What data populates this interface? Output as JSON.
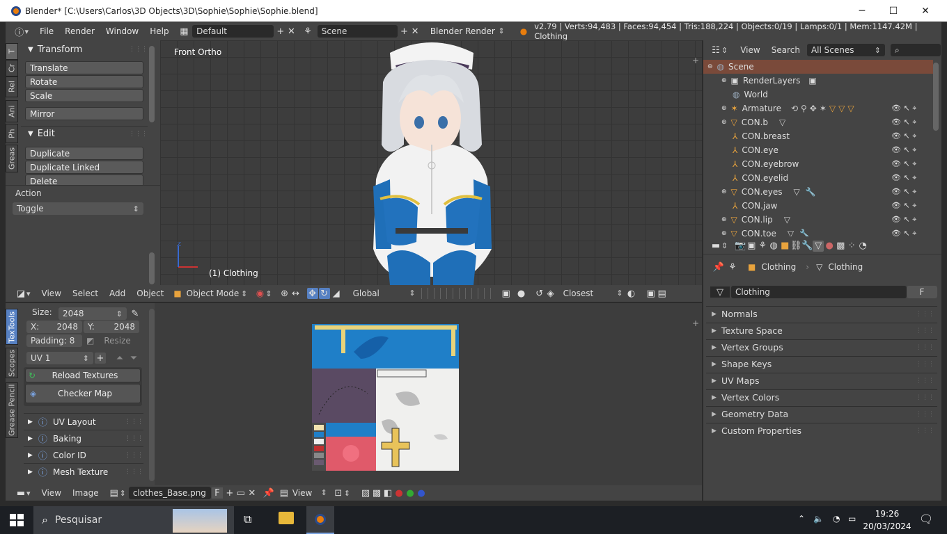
{
  "window": {
    "title": "Blender* [C:\\Users\\Carlos\\3D Objects\\3D\\Sophie\\Sophie\\Sophie.blend]",
    "minimize": "─",
    "maximize": "☐",
    "close": "✕"
  },
  "info_header": {
    "menus": [
      "File",
      "Render",
      "Window",
      "Help"
    ],
    "screen_layout": "Default",
    "scene": "Scene",
    "engine": "Blender Render",
    "stats": "v2.79 | Verts:94,483 | Faces:94,454 | Tris:188,224 | Objects:0/19 | Lamps:0/1 | Mem:1147.42M | Clothing"
  },
  "tool_shelf": {
    "tabs": [
      "T",
      "Cr",
      "Rel",
      "Ani",
      "Ph",
      "Greas"
    ],
    "transform_title": "Transform",
    "transform_buttons": [
      "Translate",
      "Rotate",
      "Scale"
    ],
    "mirror": "Mirror",
    "edit_title": "Edit",
    "edit_buttons": [
      "Duplicate",
      "Duplicate Linked",
      "Delete"
    ],
    "action_label": "Action",
    "action_value": "Toggle"
  },
  "viewport": {
    "label": "Front Ortho",
    "object_label": "(1) Clothing"
  },
  "view3d_header": {
    "menus": [
      "View",
      "Select",
      "Add",
      "Object"
    ],
    "mode": "Object Mode",
    "orientation": "Global",
    "snap": "Closest"
  },
  "image_tools": {
    "tabs": [
      "TexTools",
      "Scopes",
      "Grease Pencil"
    ],
    "size_label": "Size:",
    "size_value": "2048",
    "x_label": "X:",
    "x_value": "2048",
    "y_label": "Y:",
    "y_value": "2048",
    "padding": "Padding: 8",
    "resize": "Resize",
    "uv_map": "UV 1",
    "reload": "Reload Textures",
    "checker": "Checker Map",
    "panels": [
      "UV Layout",
      "Baking",
      "Color ID",
      "Mesh Texture"
    ]
  },
  "image_header": {
    "menus": [
      "View",
      "Image"
    ],
    "image_name": "clothes_Base.png",
    "f": "F",
    "view": "View"
  },
  "outliner": {
    "menus": [
      "View",
      "Search"
    ],
    "filter": "All Scenes",
    "rows": [
      {
        "name": "Scene",
        "indent": 0
      },
      {
        "name": "RenderLayers",
        "indent": 1
      },
      {
        "name": "World",
        "indent": 1
      },
      {
        "name": "Armature",
        "indent": 1
      },
      {
        "name": "CON.b",
        "indent": 1
      },
      {
        "name": "CON.breast",
        "indent": 1
      },
      {
        "name": "CON.eye",
        "indent": 1
      },
      {
        "name": "CON.eyebrow",
        "indent": 1
      },
      {
        "name": "CON.eyelid",
        "indent": 1
      },
      {
        "name": "CON.eyes",
        "indent": 1
      },
      {
        "name": "CON.jaw",
        "indent": 1
      },
      {
        "name": "CON.lip",
        "indent": 1
      },
      {
        "name": "CON.toe",
        "indent": 1
      }
    ]
  },
  "properties": {
    "breadcrumb_object": "Clothing",
    "breadcrumb_data": "Clothing",
    "datablock": "Clothing",
    "f": "F",
    "panels": [
      "Normals",
      "Texture Space",
      "Vertex Groups",
      "Shape Keys",
      "UV Maps",
      "Vertex Colors",
      "Geometry Data",
      "Custom Properties"
    ]
  },
  "taskbar": {
    "search": "Pesquisar",
    "time": "19:26",
    "date": "20/03/2024"
  },
  "colors": {
    "accent": "#e87d0d",
    "selected_row": "#7a4a3a",
    "uv_blue": "#1f7fc8",
    "uv_purple": "#5a4a63"
  }
}
